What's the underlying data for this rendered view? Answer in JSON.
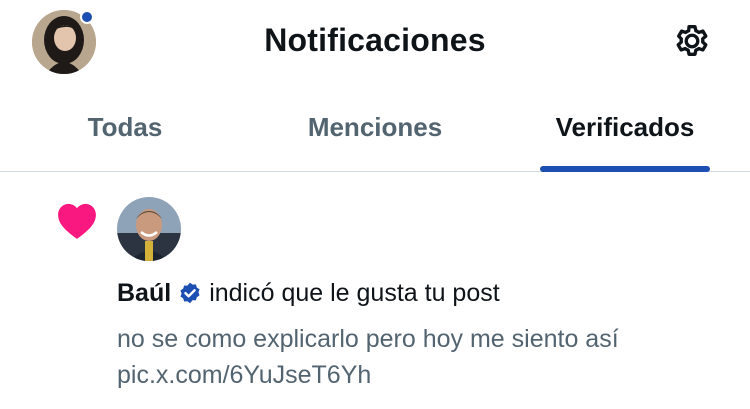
{
  "header": {
    "title": "Notificaciones",
    "avatar_icon": "user-avatar",
    "settings_icon": "gear-icon",
    "unread_dot_color": "#1d4fb3"
  },
  "tabs": [
    {
      "label": "Todas",
      "active": false
    },
    {
      "label": "Menciones",
      "active": false
    },
    {
      "label": "Verificados",
      "active": true
    }
  ],
  "notification": {
    "type_icon": "heart-icon",
    "heart_color": "#f91880",
    "actor_name": "Baúl",
    "verified_icon": "verified-badge-icon",
    "action_text": "indicó que le gusta tu post",
    "post_text_line1": "no se como explicarlo pero hoy me siento así",
    "post_text_line2": "pic.x.com/6YuJseT6Yh"
  },
  "colors": {
    "accent": "#1d4fb3",
    "secondary_text": "#536471",
    "primary_text": "#0f1419"
  }
}
